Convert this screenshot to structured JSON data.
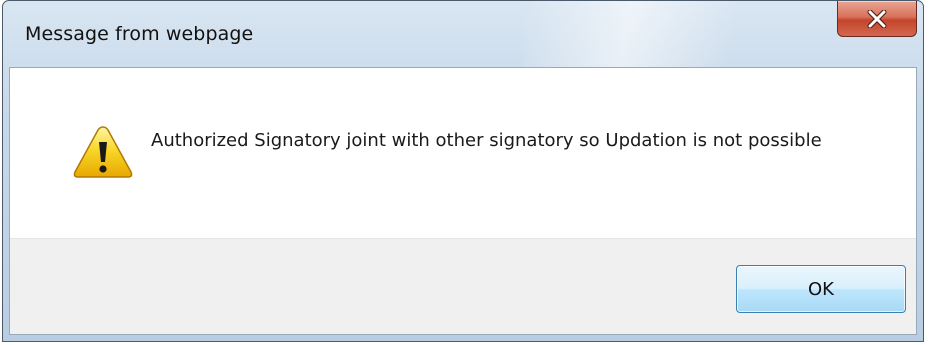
{
  "dialog": {
    "title": "Message from webpage",
    "message": "Authorized Signatory joint with other signatory so Updation is not possible",
    "ok_label": "OK",
    "icon": "warning-icon",
    "close_icon": "close-icon"
  },
  "colors": {
    "close_button": "#c3452b",
    "ok_border": "#3c7fb1",
    "button_area": "#f0f0f0",
    "warning_yellow": "#f5c400"
  }
}
